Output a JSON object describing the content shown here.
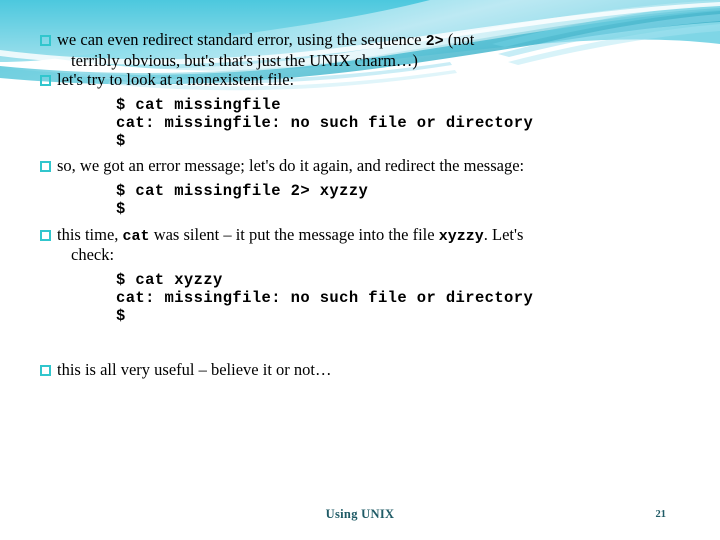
{
  "slide": {
    "footer_title": "Using UNIX",
    "page_number": "21",
    "colors": {
      "bullet_square": "#31c6cd",
      "footer_text": "#1f5b66",
      "banner_cyan": "#41c6dc",
      "banner_teal": "#2a9fb5",
      "banner_pale": "#bfe9f2",
      "body_text": "#000000"
    }
  },
  "body": {
    "bullet1": {
      "line1_pre": "we can even redirect standard error, using the sequence ",
      "line1_mono": "2>",
      "line1_post": " (not",
      "line2": "terribly obvious, but's that's just the UNIX charm…)"
    },
    "bullet2": {
      "text": "let's try to look at a nonexistent file:"
    },
    "code1": [
      "$ cat missingfile",
      "cat: missingfile: no such file or directory",
      "$"
    ],
    "bullet3": {
      "text": "so, we got an error message; let's do it again, and redirect the message:"
    },
    "code2": [
      "$ cat missingfile 2> xyzzy",
      "$"
    ],
    "bullet4": {
      "pre": "this time, ",
      "mono1": "cat",
      "mid": " was silent – it put the message into the file ",
      "mono2": "xyzzy",
      "post": ". Let's",
      "line2": "check:"
    },
    "code3": [
      "$ cat xyzzy",
      "cat: missingfile: no such file or directory",
      "$"
    ],
    "bullet5": {
      "text": "this is all very useful – believe it or not…"
    }
  }
}
